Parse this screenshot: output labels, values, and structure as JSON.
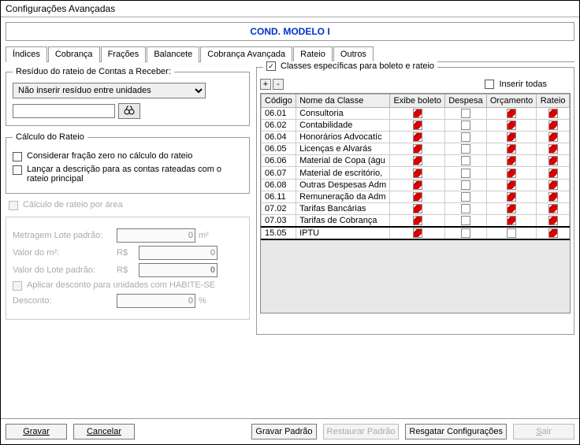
{
  "window_title": "Configurações Avançadas",
  "header_title": "COND. MODELO I",
  "tabs": [
    "Índices",
    "Cobrança",
    "Frações",
    "Balancete",
    "Cobrança Avançada",
    "Rateio",
    "Outros"
  ],
  "active_tab_index": 5,
  "residuo": {
    "legend": "Resíduo do rateio de Contas a Receber:",
    "select_value": "Não inserir resíduo entre unidades",
    "search_value": ""
  },
  "calculo": {
    "legend": "Cálculo do Rateio",
    "cb1": "Considerar fração zero no cálculo do rateio",
    "cb2": "Lançar a descrição para as contas rateadas com o rateio principal"
  },
  "area_cb": "Cálculo de rateio por área",
  "metragem": {
    "row1_label": "Metragem Lote padrão:",
    "row1_val": "0",
    "row1_unit": "m²",
    "row2_label": "Valor do m²:",
    "row2_val": "0",
    "row3_label": "Valor do Lote padrão:",
    "row3_val": "0",
    "currency": "R$",
    "habite_cb": "Aplicar desconto para unidades com HABITE-SE",
    "desc_label": "Desconto:",
    "desc_val": "0",
    "desc_unit": "%"
  },
  "classes": {
    "legend": "Classes específicas para boleto e rateio",
    "plus": "+",
    "minus": "-",
    "inserir_todas": "Inserir todas",
    "cols": [
      "Código",
      "Nome da Classe",
      "Exibe boleto",
      "Despesa",
      "Orçamento",
      "Rateio"
    ],
    "rows": [
      {
        "code": "06.01",
        "name": "Consultoria",
        "boleto": true,
        "despesa": false,
        "orc": true,
        "rateio": true
      },
      {
        "code": "06.02",
        "name": "Contabilidade",
        "boleto": true,
        "despesa": false,
        "orc": true,
        "rateio": true
      },
      {
        "code": "06.04",
        "name": "Honorários Advocatíc",
        "boleto": true,
        "despesa": false,
        "orc": true,
        "rateio": true
      },
      {
        "code": "06.05",
        "name": "Licenças e Alvarás",
        "boleto": true,
        "despesa": false,
        "orc": true,
        "rateio": true
      },
      {
        "code": "06.06",
        "name": "Material de Copa (águ",
        "boleto": true,
        "despesa": false,
        "orc": true,
        "rateio": true
      },
      {
        "code": "06.07",
        "name": "Material de escritório,",
        "boleto": true,
        "despesa": false,
        "orc": true,
        "rateio": true
      },
      {
        "code": "06.08",
        "name": "Outras Despesas Adm",
        "boleto": true,
        "despesa": false,
        "orc": true,
        "rateio": true
      },
      {
        "code": "06.11",
        "name": "Remuneração da Adm",
        "boleto": true,
        "despesa": false,
        "orc": true,
        "rateio": true
      },
      {
        "code": "07.02",
        "name": "Tarifas Bancárias",
        "boleto": true,
        "despesa": false,
        "orc": true,
        "rateio": true
      },
      {
        "code": "07.03",
        "name": "Tarifas de Cobrança",
        "boleto": true,
        "despesa": false,
        "orc": true,
        "rateio": true
      },
      {
        "code": "15.05",
        "name": "IPTU",
        "boleto": true,
        "despesa": false,
        "orc": false,
        "rateio": true,
        "selected": true
      }
    ]
  },
  "footer": {
    "gravar": "Gravar",
    "cancelar": "Cancelar",
    "gravar_padrao": "Gravar Padrão",
    "restaurar_padrao": "Restaurar Padrão",
    "resgatar": "Resgatar Configurações",
    "sair": "Sair"
  }
}
